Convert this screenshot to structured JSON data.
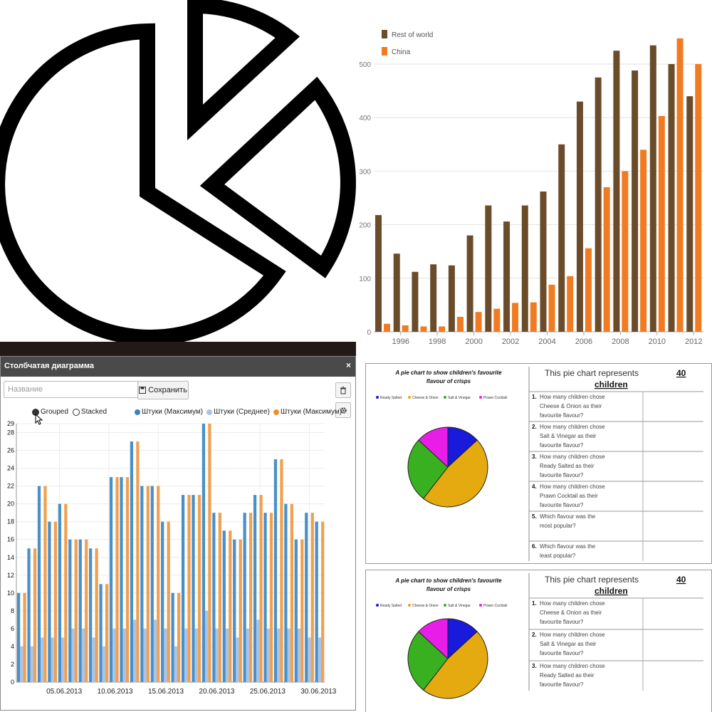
{
  "colors": {
    "icon_stroke": "#000000",
    "rest_of_world": "#6b4c2a",
    "china": "#f07b22",
    "series_max_blue": "#4a90c8",
    "series_avg": "#a9c4e6",
    "series_max_orange": "#f0a050",
    "pie_blue": "#1a1adc",
    "pie_yellow": "#e4aa10",
    "pie_green": "#38b020",
    "pie_magenta": "#e81ee8"
  },
  "icon": {
    "name": "pie-chart-icon"
  },
  "chart_data": [
    {
      "type": "bar",
      "legend": [
        "Rest of world",
        "China"
      ],
      "legend_position": "top-left",
      "x": [
        1995,
        1996,
        1997,
        1998,
        1999,
        2000,
        2001,
        2002,
        2003,
        2004,
        2005,
        2006,
        2007,
        2008,
        2009,
        2010,
        2011,
        2012
      ],
      "xticks": [
        "1996",
        "1998",
        "2000",
        "2002",
        "2004",
        "2006",
        "2008",
        "2010",
        "2012"
      ],
      "yticks": [
        "0",
        "100",
        "200",
        "300",
        "400",
        "500"
      ],
      "ylim": [
        0,
        560
      ],
      "grid": true,
      "series": [
        {
          "name": "Rest of world",
          "values": [
            218,
            146,
            112,
            126,
            124,
            180,
            236,
            206,
            236,
            262,
            350,
            430,
            475,
            525,
            488,
            535,
            500,
            440
          ]
        },
        {
          "name": "China",
          "values": [
            15,
            12,
            10,
            10,
            28,
            37,
            43,
            54,
            55,
            88,
            104,
            156,
            270,
            300,
            340,
            403,
            548,
            500
          ]
        }
      ]
    },
    {
      "type": "bar",
      "mode": "grouped",
      "ylim": [
        0,
        29
      ],
      "yticks": [
        "0",
        "2",
        "4",
        "6",
        "8",
        "10",
        "12",
        "14",
        "16",
        "18",
        "20",
        "22",
        "24",
        "26",
        "28",
        "29"
      ],
      "xticks": [
        "05.06.2013",
        "10.06.2013",
        "15.06.2013",
        "20.06.2013",
        "25.06.2013",
        "30.06.2013"
      ],
      "grid": true,
      "series": [
        {
          "name": "Штуки (Максимум)",
          "values": [
            10,
            15,
            22,
            18,
            20,
            16,
            16,
            15,
            11,
            23,
            23,
            27,
            22,
            22,
            18,
            10,
            21,
            21,
            29,
            19,
            17,
            16,
            19,
            21,
            19,
            25,
            20,
            16,
            19,
            18
          ]
        },
        {
          "name": "Штуки (Среднее)",
          "values": [
            4,
            4,
            5,
            5,
            5,
            6,
            6,
            5,
            4,
            6,
            6,
            7,
            6,
            7,
            6,
            4,
            6,
            6,
            8,
            6,
            6,
            5,
            6,
            7,
            6,
            6,
            6,
            6,
            5,
            5
          ]
        },
        {
          "name": "Штуки (Максимум)",
          "values": [
            10,
            15,
            22,
            18,
            20,
            16,
            16,
            15,
            11,
            23,
            23,
            27,
            22,
            22,
            18,
            10,
            21,
            21,
            29,
            19,
            17,
            16,
            19,
            21,
            19,
            25,
            20,
            16,
            19,
            18
          ]
        }
      ]
    },
    {
      "type": "pie",
      "title": "A pie chart to show children's favourite flavour of crisps",
      "legend": [
        "Ready Salted",
        "Cheese & Onion",
        "Salt & Vinegar",
        "Prawn Cocktail"
      ],
      "legend_position": "top",
      "slices": [
        {
          "label": "Ready Salted",
          "value": 5
        },
        {
          "label": "Cheese & Onion",
          "value": 18
        },
        {
          "label": "Salt & Vinegar",
          "value": 10
        },
        {
          "label": "Prawn Cocktail",
          "value": 5
        }
      ]
    },
    {
      "type": "pie",
      "title": "A pie chart to show children's favourite flavour of crisps",
      "legend": [
        "Ready Salted",
        "Cheese & Onion",
        "Salt & Vinegar",
        "Prawn Cocktail"
      ],
      "legend_position": "top",
      "slices": [
        {
          "label": "Ready Salted",
          "value": 5
        },
        {
          "label": "Cheese & Onion",
          "value": 18
        },
        {
          "label": "Salt & Vinegar",
          "value": 10
        },
        {
          "label": "Prawn Cocktail",
          "value": 5
        }
      ]
    }
  ],
  "widget": {
    "title": "Столбчатая диаграмма",
    "close_glyph": "×",
    "name_placeholder": "Название",
    "save_label": "Сохранить",
    "save_icon": "floppy-icon",
    "delete_icon": "trash-icon",
    "settings_icon": "gear-icon",
    "mode_grouped": "Grouped",
    "mode_stacked": "Stacked",
    "mode_selected": "Grouped",
    "legend": [
      "Штуки (Максимум)",
      "Штуки (Среднее)",
      "Штуки (Максимум)"
    ]
  },
  "worksheet": {
    "pie_title_line1": "A pie chart to show children's favourite",
    "pie_title_line2": "flavour of crisps",
    "top": {
      "header_prefix": "This pie chart represents",
      "header_number": "40",
      "header_suffix": "children",
      "questions": [
        {
          "num": "1.",
          "lines": [
            "How many children chose",
            "Cheese & Onion as their",
            "favourite flavour?"
          ]
        },
        {
          "num": "2.",
          "lines": [
            "How many children chose",
            "Salt & Vinegar as their",
            "favourite flavour?"
          ]
        },
        {
          "num": "3.",
          "lines": [
            "How many children chose",
            "Ready Salted as their",
            "favourite flavour?"
          ]
        },
        {
          "num": "4.",
          "lines": [
            "How many children chose",
            "Prawn Cocktail as their",
            "favourite flavour?"
          ]
        },
        {
          "num": "5.",
          "lines": [
            "Which flavour was the",
            "most popular?"
          ]
        },
        {
          "num": "6.",
          "lines": [
            "Which flavour was the",
            "least popular?"
          ]
        }
      ]
    },
    "bottom": {
      "header_prefix": "This pie chart represents",
      "header_number": "40",
      "header_suffix": "children",
      "questions": [
        {
          "num": "1.",
          "lines": [
            "How many children chose",
            "Cheese & Onion as their",
            "favourite flavour?"
          ]
        },
        {
          "num": "2.",
          "lines": [
            "How many children chose",
            "Salt & Vinegar as their",
            "favourite flavour?"
          ]
        },
        {
          "num": "3.",
          "lines": [
            "How many children chose",
            "Ready Salted as their",
            "favourite flavour?"
          ]
        }
      ]
    }
  }
}
